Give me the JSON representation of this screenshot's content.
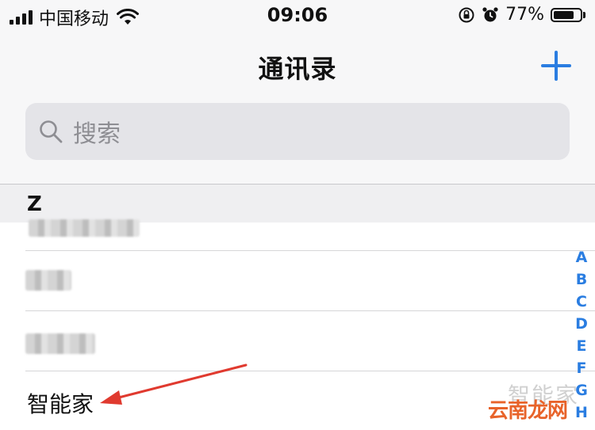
{
  "status_bar": {
    "carrier": "中国移动",
    "time": "09:06",
    "battery_percent": "77%",
    "battery_level": 0.77,
    "icons": [
      "signal-icon",
      "wifi-icon",
      "rotation-lock-icon",
      "alarm-icon",
      "battery-icon"
    ]
  },
  "nav": {
    "title": "通讯录",
    "add_icon": "plus-icon"
  },
  "search": {
    "placeholder": "搜索",
    "icon": "search-icon"
  },
  "section": {
    "letter": "Z"
  },
  "contacts": [
    {
      "name": null,
      "blurred": true
    },
    {
      "name": null,
      "blurred": true
    },
    {
      "name": null,
      "blurred": true
    },
    {
      "name": "智能家",
      "blurred": false
    }
  ],
  "index_letters": [
    "A",
    "B",
    "C",
    "D",
    "E",
    "F",
    "G",
    "H"
  ],
  "watermark": {
    "faint": "智能家",
    "main": "云南龙网"
  },
  "colors": {
    "accent": "#2a7de1",
    "arrow": "#e03a2f",
    "watermark": "#e8632a"
  }
}
